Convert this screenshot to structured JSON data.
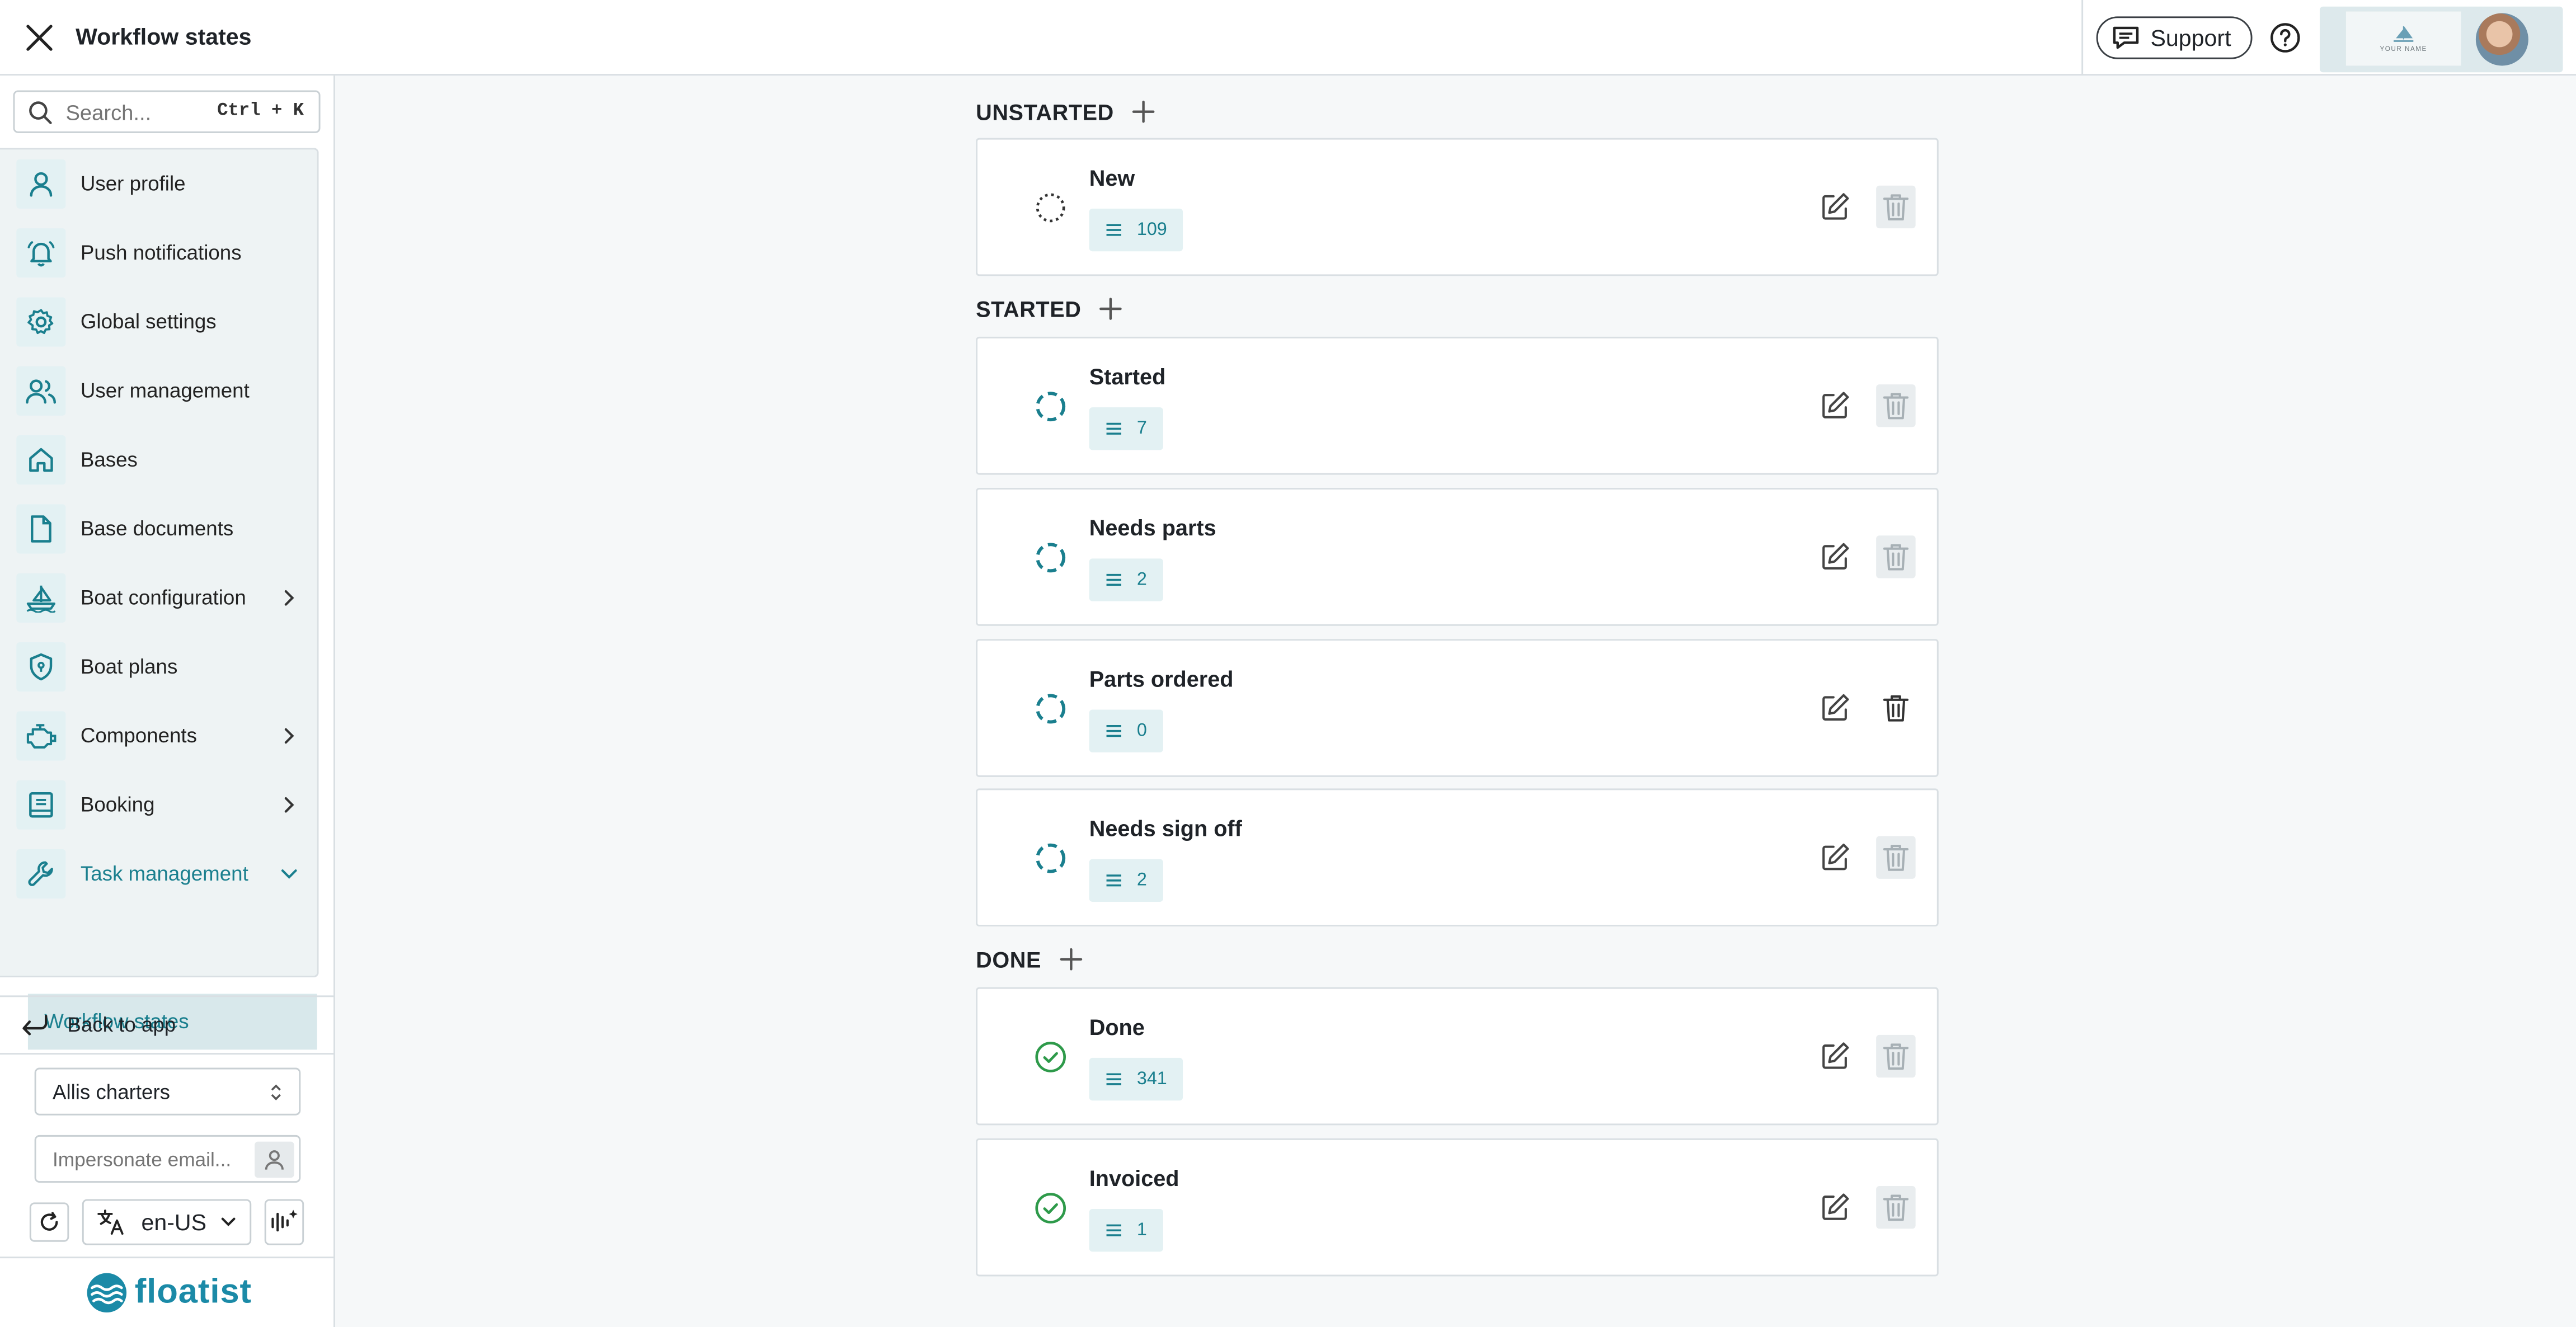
{
  "header": {
    "title": "Workflow states",
    "support_label": "Support",
    "brand_logo_text": "YOUR NAME"
  },
  "sidebar": {
    "search_placeholder": "Search...",
    "search_shortcut": "Ctrl + K",
    "items": [
      {
        "label": "User profile",
        "icon": "user-icon"
      },
      {
        "label": "Push notifications",
        "icon": "bell-icon"
      },
      {
        "label": "Global settings",
        "icon": "gear-icon"
      },
      {
        "label": "User management",
        "icon": "users-icon"
      },
      {
        "label": "Bases",
        "icon": "home-icon"
      },
      {
        "label": "Base documents",
        "icon": "document-icon"
      },
      {
        "label": "Boat configuration",
        "icon": "boat-icon",
        "expandable": true
      },
      {
        "label": "Boat plans",
        "icon": "shield-icon"
      },
      {
        "label": "Components",
        "icon": "engine-icon",
        "expandable": true
      },
      {
        "label": "Booking",
        "icon": "booking-icon",
        "expandable": true
      },
      {
        "label": "Task management",
        "icon": "wrench-icon",
        "expanded": true
      }
    ],
    "sub_item": "Workflow states",
    "back_label": "Back to app",
    "company_select": "Allis charters",
    "impersonate_placeholder": "Impersonate email...",
    "language": "en-US",
    "logo_text": "floatist"
  },
  "sections": [
    {
      "title": "UNSTARTED",
      "states": [
        {
          "name": "New",
          "count": "109",
          "status": "unstarted",
          "deletable": false
        }
      ]
    },
    {
      "title": "STARTED",
      "states": [
        {
          "name": "Started",
          "count": "7",
          "status": "started",
          "deletable": false
        },
        {
          "name": "Needs parts",
          "count": "2",
          "status": "started",
          "deletable": false
        },
        {
          "name": "Parts ordered",
          "count": "0",
          "status": "started",
          "deletable": true
        },
        {
          "name": "Needs sign off",
          "count": "2",
          "status": "started",
          "deletable": false
        }
      ]
    },
    {
      "title": "DONE",
      "states": [
        {
          "name": "Done",
          "count": "341",
          "status": "done",
          "deletable": false
        },
        {
          "name": "Invoiced",
          "count": "1",
          "status": "done",
          "deletable": false
        }
      ]
    }
  ],
  "colors": {
    "accent": "#1a7f8e",
    "done": "#2e9a4a"
  }
}
